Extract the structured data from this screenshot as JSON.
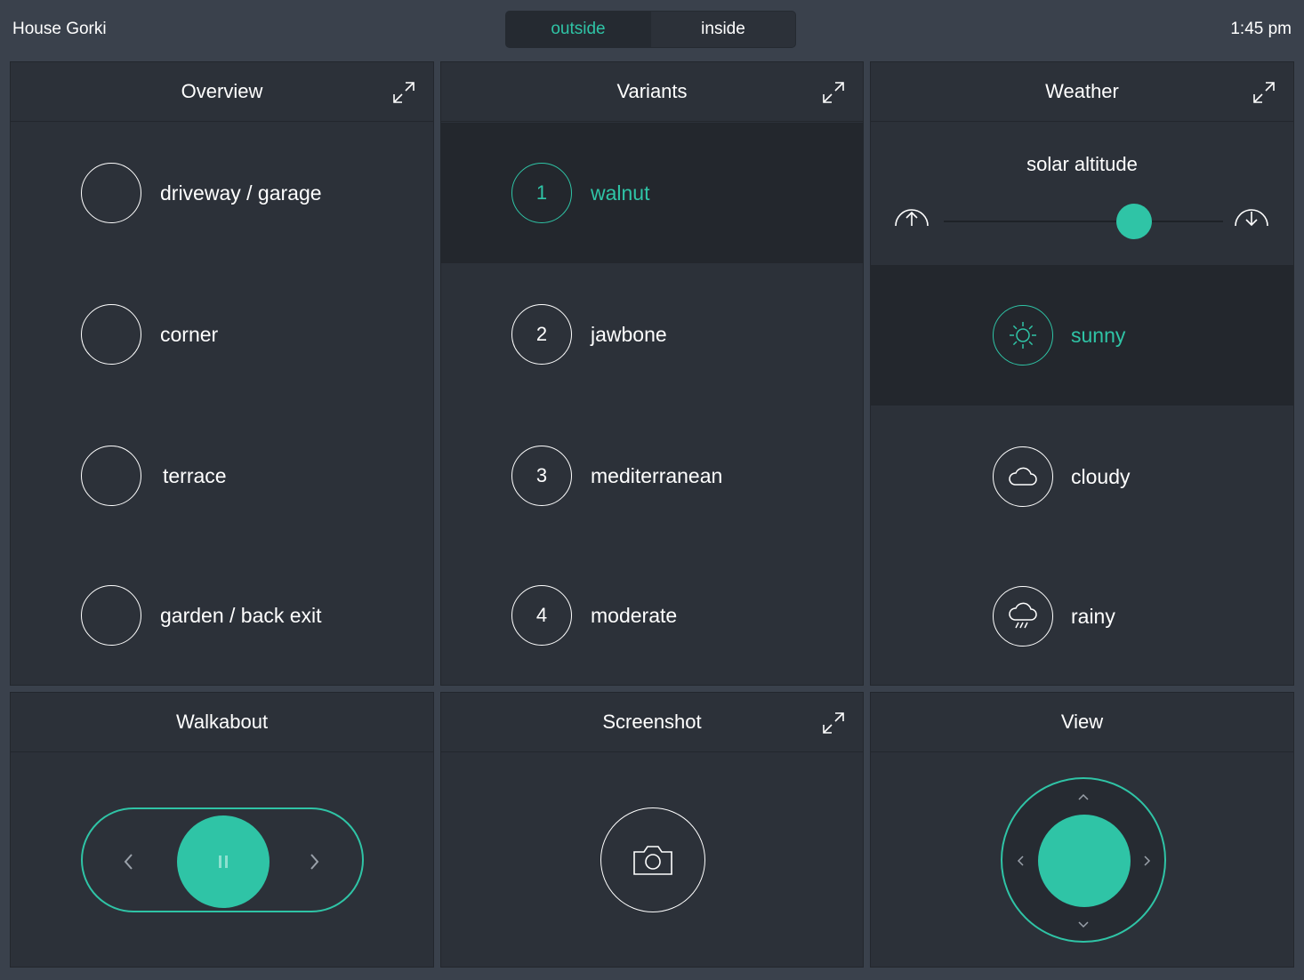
{
  "header": {
    "app_title": "House Gorki",
    "clock": "1:45 pm",
    "mode_tabs": [
      {
        "label": "outside",
        "active": true
      },
      {
        "label": "inside",
        "active": false
      }
    ]
  },
  "colors": {
    "accent": "#2fc4a6",
    "panel_bg": "#2c3139",
    "page_bg": "#3a414c",
    "selected_row_bg": "#23272d"
  },
  "overview": {
    "title": "Overview",
    "items": [
      {
        "label": "driveway / garage"
      },
      {
        "label": "corner"
      },
      {
        "label": "terrace"
      },
      {
        "label": "garden / back exit"
      }
    ]
  },
  "variants": {
    "title": "Variants",
    "selected_index": 0,
    "items": [
      {
        "number": "1",
        "label": "walnut"
      },
      {
        "number": "2",
        "label": "jawbone"
      },
      {
        "number": "3",
        "label": "mediterranean"
      },
      {
        "number": "4",
        "label": "moderate"
      }
    ]
  },
  "weather": {
    "title": "Weather",
    "solar_label": "solar altitude",
    "solar_level": 0.68,
    "selected_index": 0,
    "items": [
      {
        "icon": "sun-icon",
        "label": "sunny"
      },
      {
        "icon": "cloud-icon",
        "label": "cloudy"
      },
      {
        "icon": "rain-cloud-icon",
        "label": "rainy"
      }
    ]
  },
  "walkabout": {
    "title": "Walkabout",
    "state": "playing"
  },
  "screenshot": {
    "title": "Screenshot"
  },
  "view": {
    "title": "View"
  }
}
